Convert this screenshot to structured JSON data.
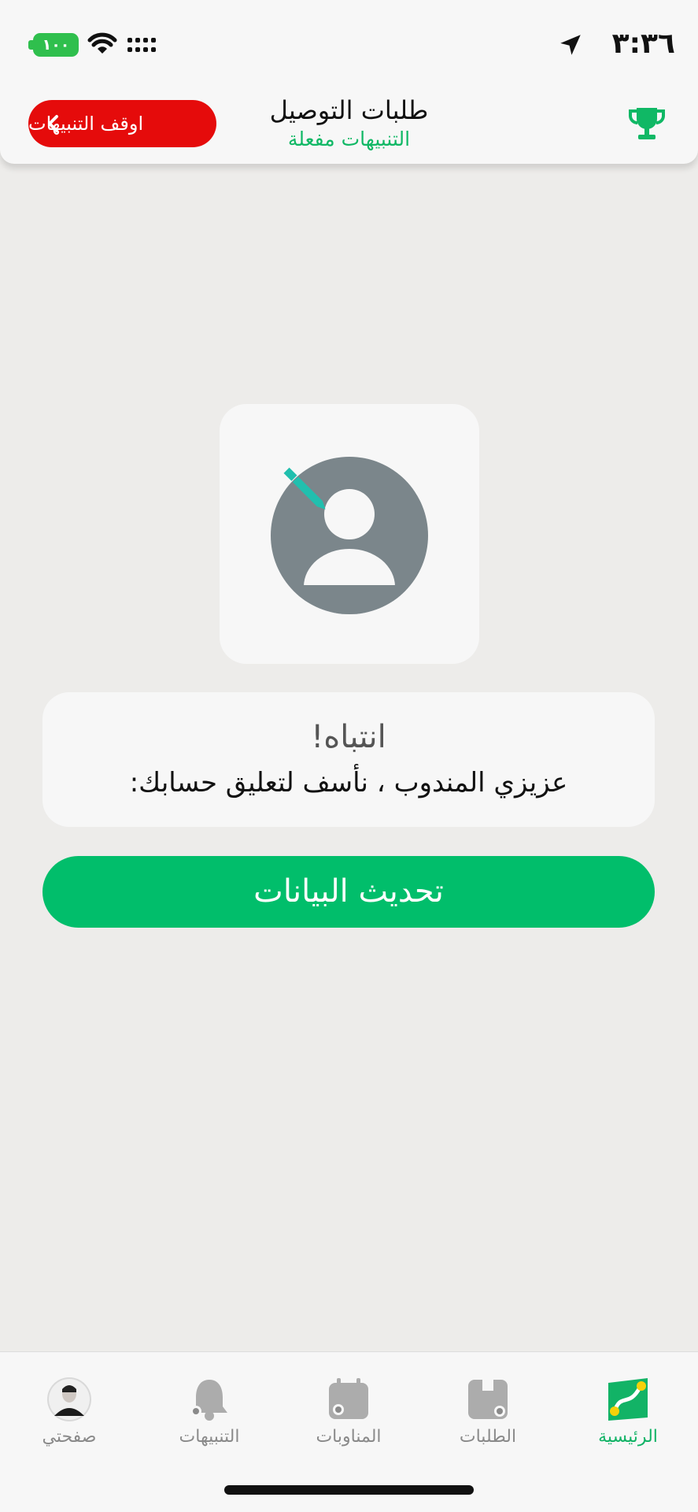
{
  "status_bar": {
    "time": "٣:٣٦",
    "battery": "١٠٠",
    "icons": [
      "location-arrow-icon",
      "wifi-icon",
      "signal-icon"
    ]
  },
  "header": {
    "title": "طلبات التوصيل",
    "subtitle": "التنبيهات مفعلة",
    "stop_button_label": "اوقف التنبيهات",
    "trophy_icon": "trophy-icon"
  },
  "alert": {
    "title": "انتباه!",
    "message": "عزيزي المندوب ، نأسف لتعليق حسابك:"
  },
  "refresh_button_label": "تحديث البيانات",
  "tabs": [
    {
      "label": "الرئيسية",
      "icon": "route-map-icon",
      "active": true
    },
    {
      "label": "الطلبات",
      "icon": "orders-box-icon",
      "active": false
    },
    {
      "label": "المناوبات",
      "icon": "calendar-icon",
      "active": false
    },
    {
      "label": "التنبيهات",
      "icon": "bell-icon",
      "active": false
    },
    {
      "label": "صفحتي",
      "icon": "profile-avatar",
      "active": false
    }
  ],
  "colors": {
    "accent_green": "#01be6b",
    "alert_red": "#e50b0b",
    "background": "#edecea",
    "card": "#f7f7f7"
  }
}
